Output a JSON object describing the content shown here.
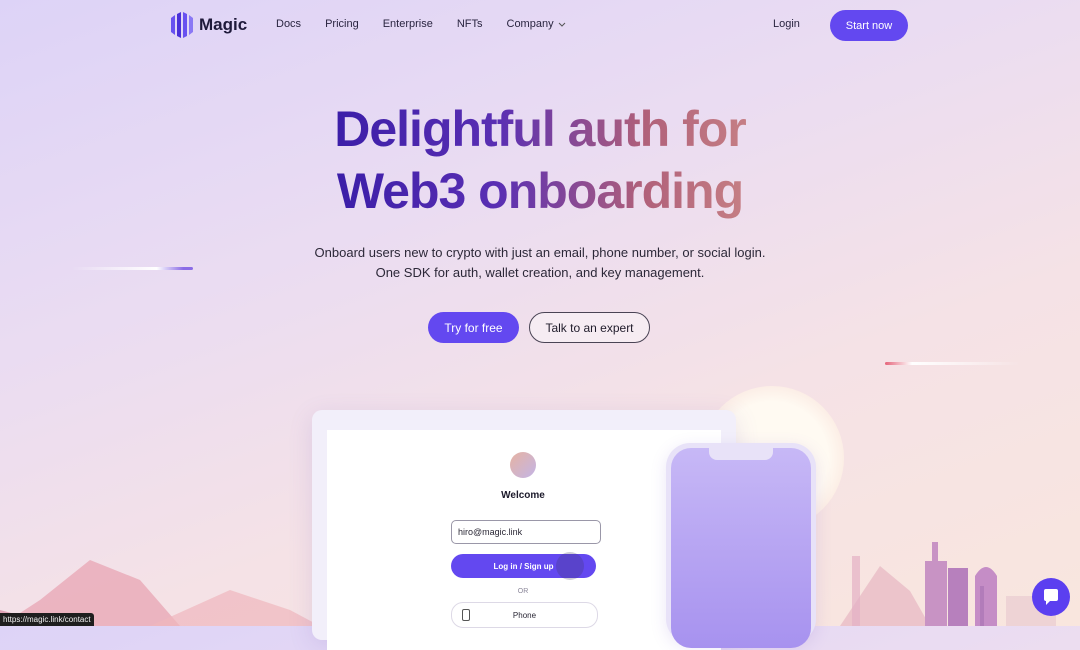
{
  "nav": {
    "logo_text": "Magic",
    "links": [
      "Docs",
      "Pricing",
      "Enterprise",
      "NFTs",
      "Company"
    ],
    "login": "Login",
    "start": "Start now"
  },
  "hero": {
    "title_line1": "Delightful auth for",
    "title_line2": "Web3 onboarding",
    "subtitle_line1": "Onboard users new to crypto with just an email, phone number, or social login.",
    "subtitle_line2": "One SDK for auth, wallet creation, and key management.",
    "cta_primary": "Try for free",
    "cta_secondary": "Talk to an expert"
  },
  "demo": {
    "welcome": "Welcome",
    "email_value": "hiro@magic.link",
    "login_button": "Log in / Sign up",
    "or": "OR",
    "phone_button": "Phone"
  },
  "status_url": "https://magic.link/contact",
  "colors": {
    "accent": "#6348f0",
    "title_gradient_start": "#3b1ea8",
    "title_gradient_end": "#c57e84"
  }
}
